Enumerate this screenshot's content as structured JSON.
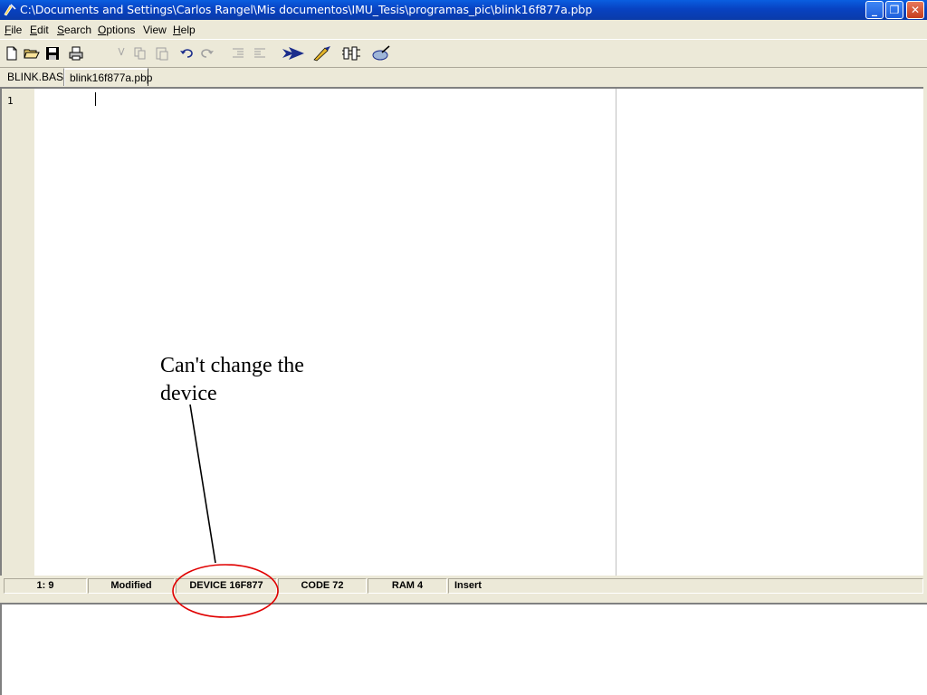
{
  "window": {
    "title": "C:\\Documents and Settings\\Carlos Rangel\\Mis documentos\\IMU_Tesis\\programas_pic\\blink16f877a.pbp",
    "minimize_label": "_",
    "maximize_label": "❐",
    "close_label": "✕"
  },
  "menu": {
    "items": [
      {
        "accel": "F",
        "rest": "ile"
      },
      {
        "accel": "E",
        "rest": "dit"
      },
      {
        "accel": "S",
        "rest": "earch"
      },
      {
        "accel": "O",
        "rest": "ptions"
      },
      {
        "accel": "",
        "rest": "View"
      },
      {
        "accel": "H",
        "rest": "elp"
      }
    ]
  },
  "toolbar": {
    "icons": [
      "new-file-icon",
      "open-folder-icon",
      "save-icon",
      "print-icon",
      "cut-icon",
      "copy-icon",
      "paste-icon",
      "undo-icon",
      "redo-icon",
      "indent-icon",
      "outdent-icon",
      "compile-arrow-icon",
      "compile-program-icon",
      "programmer-icon",
      "device-chip-icon"
    ]
  },
  "tabs": [
    {
      "label": "BLINK.BAS",
      "active": false
    },
    {
      "label": "blink16f877a.pbp",
      "active": true
    }
  ],
  "editor": {
    "line_number": "1"
  },
  "status": {
    "position": "1:  9",
    "modified": "Modified",
    "device": "DEVICE 16F877",
    "code": "CODE 72",
    "ram": "RAM 4",
    "mode": "Insert"
  },
  "annotation": {
    "text_line1": "Can't change the",
    "text_line2": "device",
    "color": "#e00000"
  },
  "colors": {
    "titlebar": "#0842c2",
    "chrome": "#ece9d8",
    "compile_arrow": "#1b2d8c"
  }
}
